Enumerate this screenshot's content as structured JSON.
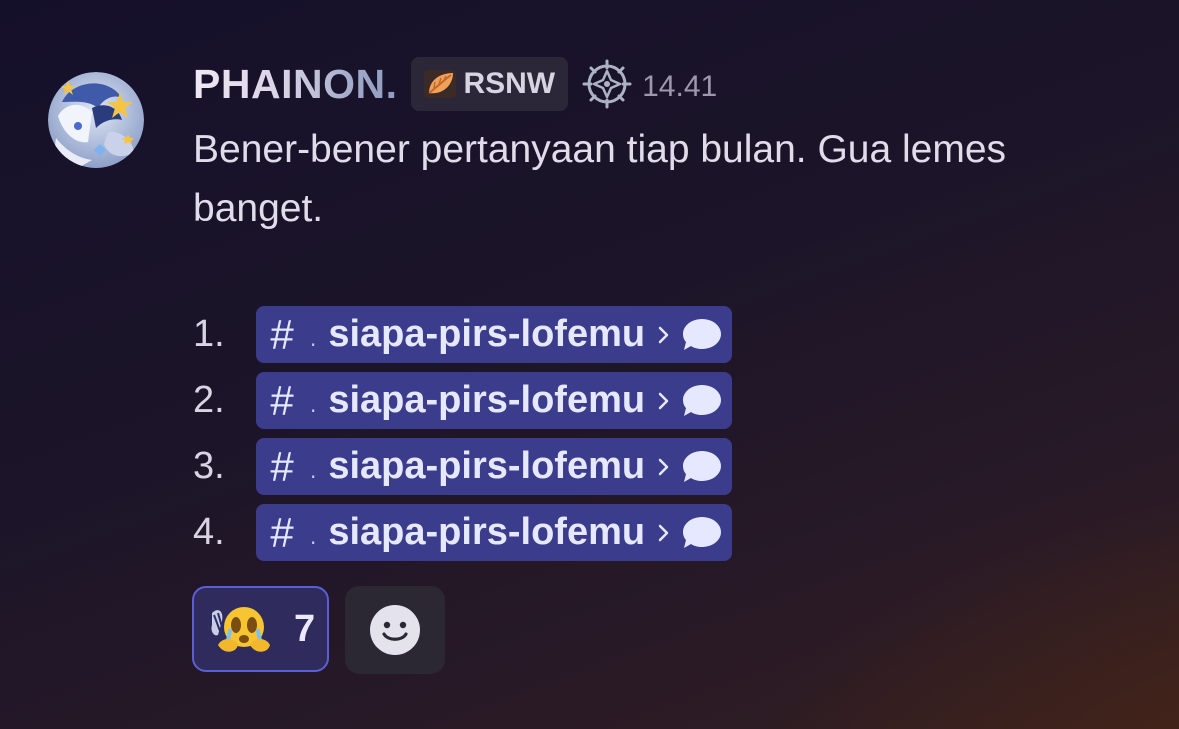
{
  "author": {
    "name": "PHAINON.",
    "tag": "RSNW",
    "timestamp": "14.41",
    "avatar_icon": "anime-character-avatar",
    "tag_icon": "orange-leaf-icon",
    "role_icon": "compass-star-emblem-icon"
  },
  "message": {
    "text": "Bener-bener pertanyaan tiap bulan. Gua lemes banget."
  },
  "list": [
    {
      "number": "1.",
      "hash": "#",
      "dot": ".",
      "channel": "siapa-pirs-lofemu"
    },
    {
      "number": "2.",
      "hash": "#",
      "dot": ".",
      "channel": "siapa-pirs-lofemu"
    },
    {
      "number": "3.",
      "hash": "#",
      "dot": ".",
      "channel": "siapa-pirs-lofemu"
    },
    {
      "number": "4.",
      "hash": "#",
      "dot": ".",
      "channel": "siapa-pirs-lofemu"
    }
  ],
  "reactions": [
    {
      "emoji": "crying-clapping-emoji",
      "count": "7"
    }
  ],
  "add_reaction_icon": "smiley-face-icon",
  "colors": {
    "mention_bg": "#3b3c8c",
    "reaction_border": "#5b5fd6",
    "reaction_bg": "#2f2b5c",
    "tag_bg": "#2c2738"
  }
}
